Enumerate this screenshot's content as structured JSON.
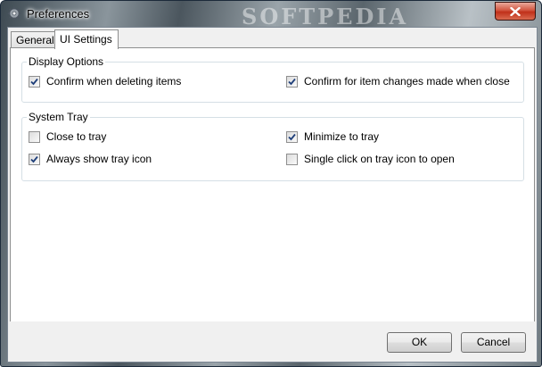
{
  "window": {
    "title": "Preferences",
    "watermark": "SOFTPEDIA",
    "icons": {
      "app": "gear-icon",
      "close": "close-icon"
    }
  },
  "tabs": [
    {
      "label": "General",
      "active": false
    },
    {
      "label": "UI Settings",
      "active": true
    }
  ],
  "display_options": {
    "title": "Display Options",
    "items": [
      {
        "label": "Confirm when deleting items",
        "checked": true
      },
      {
        "label": "Confirm for item changes made when close",
        "checked": true
      }
    ]
  },
  "system_tray": {
    "title": "System Tray",
    "items": [
      {
        "label": "Close to tray",
        "checked": false
      },
      {
        "label": "Minimize to tray",
        "checked": true
      },
      {
        "label": "Always show tray icon",
        "checked": true
      },
      {
        "label": "Single click on tray icon to open",
        "checked": false
      }
    ]
  },
  "buttons": {
    "ok": "OK",
    "cancel": "Cancel"
  },
  "colors": {
    "check_mark": "#1f3f7a",
    "close_button": "#c7402a",
    "dialog_bg": "#f0f0f0"
  }
}
